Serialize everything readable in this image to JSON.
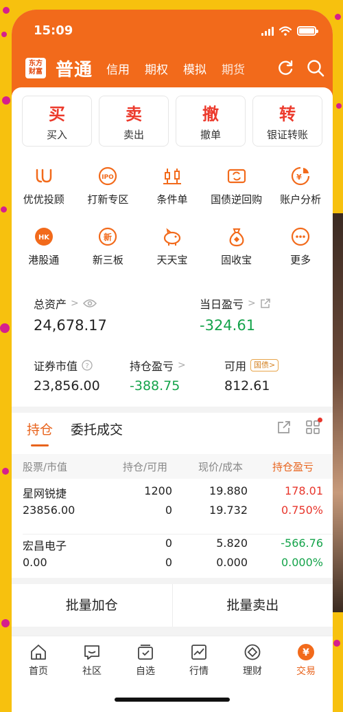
{
  "status": {
    "time": "15:09"
  },
  "header": {
    "logo_line1": "东方",
    "logo_line2": "财富",
    "mode": "普通",
    "tabs": [
      "信用",
      "期权",
      "模拟",
      "期货"
    ],
    "icons": [
      "refresh-icon",
      "search-icon"
    ]
  },
  "actions": [
    {
      "big": "买",
      "small": "买入"
    },
    {
      "big": "卖",
      "small": "卖出"
    },
    {
      "big": "撤",
      "small": "撤单"
    },
    {
      "big": "转",
      "small": "银证转账"
    }
  ],
  "grid_row1": [
    {
      "label": "优优投顾",
      "icon": "uu-advisor-icon"
    },
    {
      "label": "打新专区",
      "icon": "ipo-icon"
    },
    {
      "label": "条件单",
      "icon": "candlestick-icon"
    },
    {
      "label": "国债逆回购",
      "icon": "repo-icon"
    },
    {
      "label": "账户分析",
      "icon": "analysis-icon"
    }
  ],
  "grid_row2": [
    {
      "label": "港股通",
      "icon": "hk-icon"
    },
    {
      "label": "新三板",
      "icon": "new-board-icon"
    },
    {
      "label": "天天宝",
      "icon": "piggy-icon"
    },
    {
      "label": "固收宝",
      "icon": "moneybag-icon"
    },
    {
      "label": "更多",
      "icon": "more-icon"
    }
  ],
  "assets": {
    "total_label": "总资产",
    "total_value": "24,678.17",
    "daily_label": "当日盈亏",
    "daily_value": "-324.61",
    "market_label": "证券市值",
    "market_value": "23,856.00",
    "holding_label": "持仓盈亏",
    "holding_value": "-388.75",
    "avail_label": "可用",
    "avail_value": "812.61",
    "badge": "国债>"
  },
  "positions": {
    "tab_active": "持仓",
    "tab_other": "委托成交",
    "headers": {
      "stock": "股票/市值",
      "hold": "持仓/可用",
      "price": "现价/成本",
      "pl": "持仓盈亏"
    },
    "rows": [
      {
        "name": "星网锐捷",
        "mv": "23856.00",
        "hold": "1200",
        "avail": "0",
        "price": "19.880",
        "cost": "19.732",
        "pl": "178.01",
        "plpct": "0.750%"
      },
      {
        "name": "宏昌电子",
        "mv": "0.00",
        "hold": "0",
        "avail": "0",
        "price": "5.820",
        "cost": "0.000",
        "pl": "-566.76",
        "plpct": "0.000%"
      }
    ]
  },
  "buttons": {
    "add": "批量加仓",
    "sell": "批量卖出"
  },
  "tabbar": [
    {
      "label": "首页",
      "icon": "home-icon"
    },
    {
      "label": "社区",
      "icon": "community-icon"
    },
    {
      "label": "自选",
      "icon": "watchlist-icon"
    },
    {
      "label": "行情",
      "icon": "market-icon"
    },
    {
      "label": "理财",
      "icon": "wealth-icon"
    },
    {
      "label": "交易",
      "icon": "trade-icon"
    }
  ],
  "colors": {
    "brand": "#f26a1b",
    "up": "#e8362c",
    "down": "#14a34a"
  }
}
